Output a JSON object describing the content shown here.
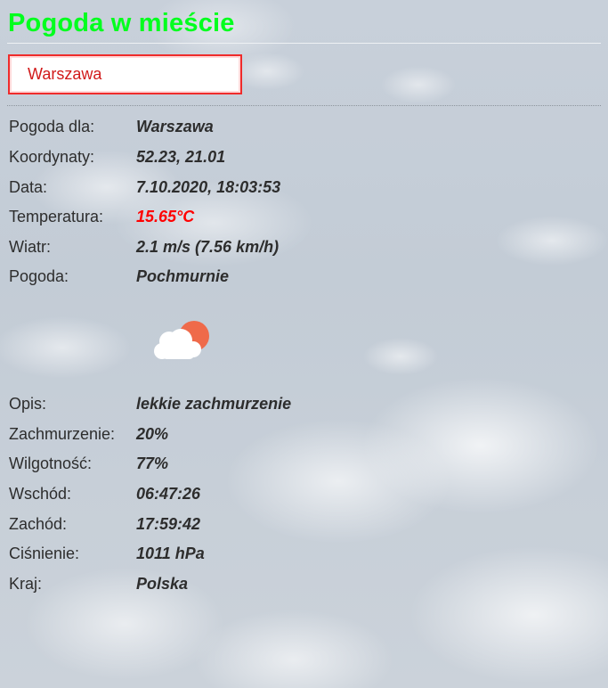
{
  "header": {
    "title": "Pogoda w mieście"
  },
  "search": {
    "value": "Warszawa"
  },
  "weather": {
    "rows_top": [
      {
        "label": "Pogoda dla:",
        "value": "Warszawa"
      },
      {
        "label": "Koordynaty:",
        "value": "52.23, 21.01"
      },
      {
        "label": "Data:",
        "value": "7.10.2020, 18:03:53"
      },
      {
        "label": "Temperatura:",
        "value": "15.65°C"
      },
      {
        "label": "Wiatr:",
        "value": "2.1 m/s (7.56 km/h)"
      },
      {
        "label": "Pogoda:",
        "value": "Pochmurnie"
      }
    ],
    "icon": "partly-cloudy-icon",
    "rows_bottom": [
      {
        "label": "Opis:",
        "value": "lekkie zachmurzenie"
      },
      {
        "label": "Zachmurzenie:",
        "value": "20%"
      },
      {
        "label": "Wilgotność:",
        "value": "77%"
      },
      {
        "label": "Wschód:",
        "value": "06:47:26"
      },
      {
        "label": "Zachód:",
        "value": "17:59:42"
      },
      {
        "label": "Ciśnienie:",
        "value": "1011 hPa"
      },
      {
        "label": "Kraj:",
        "value": "Polska"
      }
    ]
  },
  "colors": {
    "title": "#00ff1e",
    "temperature": "#ff0000",
    "input_border": "#ef2b2b",
    "input_text": "#d11a1a",
    "sun": "#ef6a4a"
  }
}
